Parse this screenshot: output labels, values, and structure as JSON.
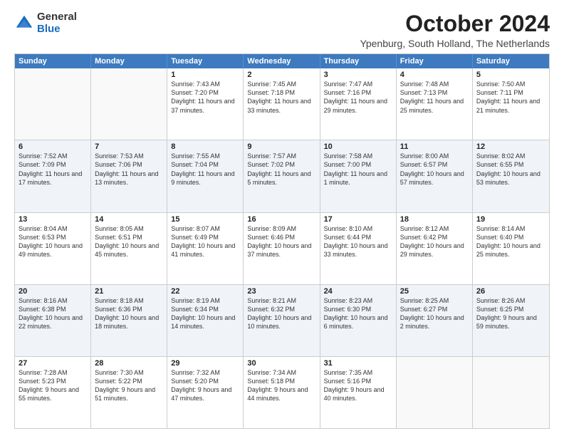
{
  "logo": {
    "general": "General",
    "blue": "Blue"
  },
  "title": "October 2024",
  "subtitle": "Ypenburg, South Holland, The Netherlands",
  "headers": [
    "Sunday",
    "Monday",
    "Tuesday",
    "Wednesday",
    "Thursday",
    "Friday",
    "Saturday"
  ],
  "rows": [
    [
      {
        "day": "",
        "info": "",
        "empty": true
      },
      {
        "day": "",
        "info": "",
        "empty": true
      },
      {
        "day": "1",
        "info": "Sunrise: 7:43 AM\nSunset: 7:20 PM\nDaylight: 11 hours\nand 37 minutes.",
        "empty": false
      },
      {
        "day": "2",
        "info": "Sunrise: 7:45 AM\nSunset: 7:18 PM\nDaylight: 11 hours\nand 33 minutes.",
        "empty": false
      },
      {
        "day": "3",
        "info": "Sunrise: 7:47 AM\nSunset: 7:16 PM\nDaylight: 11 hours\nand 29 minutes.",
        "empty": false
      },
      {
        "day": "4",
        "info": "Sunrise: 7:48 AM\nSunset: 7:13 PM\nDaylight: 11 hours\nand 25 minutes.",
        "empty": false
      },
      {
        "day": "5",
        "info": "Sunrise: 7:50 AM\nSunset: 7:11 PM\nDaylight: 11 hours\nand 21 minutes.",
        "empty": false
      }
    ],
    [
      {
        "day": "6",
        "info": "Sunrise: 7:52 AM\nSunset: 7:09 PM\nDaylight: 11 hours\nand 17 minutes.",
        "empty": false
      },
      {
        "day": "7",
        "info": "Sunrise: 7:53 AM\nSunset: 7:06 PM\nDaylight: 11 hours\nand 13 minutes.",
        "empty": false
      },
      {
        "day": "8",
        "info": "Sunrise: 7:55 AM\nSunset: 7:04 PM\nDaylight: 11 hours\nand 9 minutes.",
        "empty": false
      },
      {
        "day": "9",
        "info": "Sunrise: 7:57 AM\nSunset: 7:02 PM\nDaylight: 11 hours\nand 5 minutes.",
        "empty": false
      },
      {
        "day": "10",
        "info": "Sunrise: 7:58 AM\nSunset: 7:00 PM\nDaylight: 11 hours\nand 1 minute.",
        "empty": false
      },
      {
        "day": "11",
        "info": "Sunrise: 8:00 AM\nSunset: 6:57 PM\nDaylight: 10 hours\nand 57 minutes.",
        "empty": false
      },
      {
        "day": "12",
        "info": "Sunrise: 8:02 AM\nSunset: 6:55 PM\nDaylight: 10 hours\nand 53 minutes.",
        "empty": false
      }
    ],
    [
      {
        "day": "13",
        "info": "Sunrise: 8:04 AM\nSunset: 6:53 PM\nDaylight: 10 hours\nand 49 minutes.",
        "empty": false
      },
      {
        "day": "14",
        "info": "Sunrise: 8:05 AM\nSunset: 6:51 PM\nDaylight: 10 hours\nand 45 minutes.",
        "empty": false
      },
      {
        "day": "15",
        "info": "Sunrise: 8:07 AM\nSunset: 6:49 PM\nDaylight: 10 hours\nand 41 minutes.",
        "empty": false
      },
      {
        "day": "16",
        "info": "Sunrise: 8:09 AM\nSunset: 6:46 PM\nDaylight: 10 hours\nand 37 minutes.",
        "empty": false
      },
      {
        "day": "17",
        "info": "Sunrise: 8:10 AM\nSunset: 6:44 PM\nDaylight: 10 hours\nand 33 minutes.",
        "empty": false
      },
      {
        "day": "18",
        "info": "Sunrise: 8:12 AM\nSunset: 6:42 PM\nDaylight: 10 hours\nand 29 minutes.",
        "empty": false
      },
      {
        "day": "19",
        "info": "Sunrise: 8:14 AM\nSunset: 6:40 PM\nDaylight: 10 hours\nand 25 minutes.",
        "empty": false
      }
    ],
    [
      {
        "day": "20",
        "info": "Sunrise: 8:16 AM\nSunset: 6:38 PM\nDaylight: 10 hours\nand 22 minutes.",
        "empty": false
      },
      {
        "day": "21",
        "info": "Sunrise: 8:18 AM\nSunset: 6:36 PM\nDaylight: 10 hours\nand 18 minutes.",
        "empty": false
      },
      {
        "day": "22",
        "info": "Sunrise: 8:19 AM\nSunset: 6:34 PM\nDaylight: 10 hours\nand 14 minutes.",
        "empty": false
      },
      {
        "day": "23",
        "info": "Sunrise: 8:21 AM\nSunset: 6:32 PM\nDaylight: 10 hours\nand 10 minutes.",
        "empty": false
      },
      {
        "day": "24",
        "info": "Sunrise: 8:23 AM\nSunset: 6:30 PM\nDaylight: 10 hours\nand 6 minutes.",
        "empty": false
      },
      {
        "day": "25",
        "info": "Sunrise: 8:25 AM\nSunset: 6:27 PM\nDaylight: 10 hours\nand 2 minutes.",
        "empty": false
      },
      {
        "day": "26",
        "info": "Sunrise: 8:26 AM\nSunset: 6:25 PM\nDaylight: 9 hours\nand 59 minutes.",
        "empty": false
      }
    ],
    [
      {
        "day": "27",
        "info": "Sunrise: 7:28 AM\nSunset: 5:23 PM\nDaylight: 9 hours\nand 55 minutes.",
        "empty": false
      },
      {
        "day": "28",
        "info": "Sunrise: 7:30 AM\nSunset: 5:22 PM\nDaylight: 9 hours\nand 51 minutes.",
        "empty": false
      },
      {
        "day": "29",
        "info": "Sunrise: 7:32 AM\nSunset: 5:20 PM\nDaylight: 9 hours\nand 47 minutes.",
        "empty": false
      },
      {
        "day": "30",
        "info": "Sunrise: 7:34 AM\nSunset: 5:18 PM\nDaylight: 9 hours\nand 44 minutes.",
        "empty": false
      },
      {
        "day": "31",
        "info": "Sunrise: 7:35 AM\nSunset: 5:16 PM\nDaylight: 9 hours\nand 40 minutes.",
        "empty": false
      },
      {
        "day": "",
        "info": "",
        "empty": true
      },
      {
        "day": "",
        "info": "",
        "empty": true
      }
    ]
  ]
}
